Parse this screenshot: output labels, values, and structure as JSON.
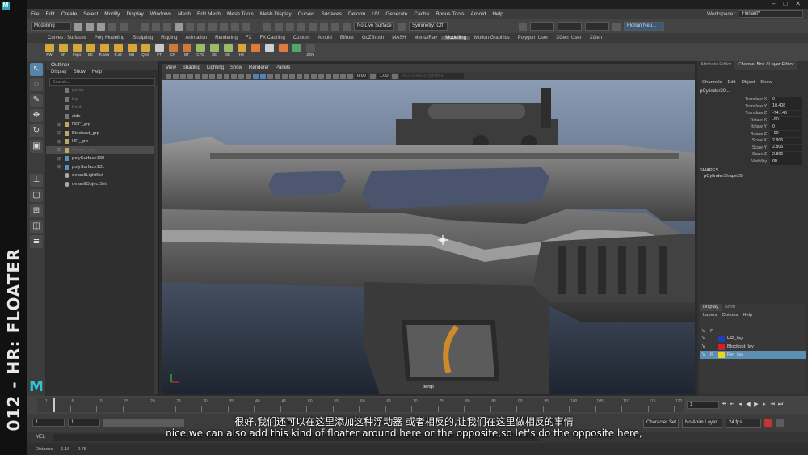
{
  "banner": {
    "text": "012 - HR: FLOATER",
    "logo": "M"
  },
  "menubar": {
    "items": [
      "File",
      "Edit",
      "Create",
      "Select",
      "Modify",
      "Display",
      "Windows",
      "Mesh",
      "Edit Mesh",
      "Mesh Tools",
      "Mesh Display",
      "Curves",
      "Surfaces",
      "Deform",
      "UV",
      "Generate",
      "Cache",
      "Bonus Tools",
      "Arnold",
      "Help"
    ],
    "workspace_label": "Workspace :",
    "workspace_value": "Floriant*"
  },
  "statusline": {
    "mode": "Modelling",
    "no_live_surface": "No Live Surface",
    "symmetry": "Symmetry: Off",
    "user": "Florian Neu..."
  },
  "shelf": {
    "tabs": [
      "Curves / Surfaces",
      "Poly Modeling",
      "Sculpting",
      "Rigging",
      "Animation",
      "Rendering",
      "FX",
      "FX Caching",
      "Custom",
      "Arnold",
      "Bifrost",
      "GoZBrush",
      "MASH",
      "MentalRay",
      "Modelling",
      "Motion Graphics",
      "Polygon_User",
      "XGen_User",
      "XGen"
    ],
    "active_tab": "Modelling",
    "buttons": [
      {
        "label": "PW",
        "color": "#d8a73a"
      },
      {
        "label": "SP",
        "color": "#d8a73a"
      },
      {
        "label": "Impo",
        "color": "#d8a73a"
      },
      {
        "label": "EE",
        "color": "#d8a73a"
      },
      {
        "label": "R.sew",
        "color": "#d8a73a"
      },
      {
        "label": "R.all",
        "color": "#d8a73a"
      },
      {
        "label": "NH",
        "color": "#d8a73a"
      },
      {
        "label": "QSS",
        "color": "#d8a73a"
      },
      {
        "label": "FT",
        "color": "#c9c9c9"
      },
      {
        "label": "CP",
        "color": "#d07a3a"
      },
      {
        "label": "BT",
        "color": "#d07a3a"
      },
      {
        "label": "CFD",
        "color": "#9bbb6a"
      },
      {
        "label": "SE",
        "color": "#9bbb6a"
      },
      {
        "label": "SE",
        "color": "#9bbb6a"
      },
      {
        "label": "HE",
        "color": "#d8a73a"
      },
      {
        "label": "",
        "color": "#e07b39"
      },
      {
        "label": "",
        "color": "#cfcfcf"
      },
      {
        "label": "",
        "color": "#e07b39"
      },
      {
        "label": "",
        "color": "#58a36a"
      },
      {
        "label": "ZEN",
        "color": "#555555"
      }
    ]
  },
  "outliner": {
    "title": "Outliner",
    "menu": [
      "Display",
      "Show",
      "Help"
    ],
    "search_placeholder": "Search...",
    "items": [
      {
        "label": "persp",
        "type": "cam",
        "dim": true,
        "expand": false
      },
      {
        "label": "top",
        "type": "cam",
        "dim": true,
        "expand": false
      },
      {
        "label": "front",
        "type": "cam",
        "dim": true,
        "expand": false
      },
      {
        "label": "side",
        "type": "cam",
        "dim": false,
        "expand": false
      },
      {
        "label": "REF_grp",
        "type": "grp",
        "dim": false,
        "expand": true
      },
      {
        "label": "Blockout_grp",
        "type": "grp",
        "dim": false,
        "expand": true
      },
      {
        "label": "HR_grp",
        "type": "grp",
        "dim": false,
        "expand": true
      },
      {
        "label": "Floater_grp",
        "type": "grp",
        "dim": false,
        "expand": true,
        "selected": true
      },
      {
        "label": "polySurface130",
        "type": "mesh",
        "dim": false,
        "expand": true
      },
      {
        "label": "polySurface131",
        "type": "mesh",
        "dim": false,
        "expand": true
      },
      {
        "label": "defaultLightSet",
        "type": "set",
        "dim": false,
        "expand": false
      },
      {
        "label": "defaultObjectSet",
        "type": "set",
        "dim": false,
        "expand": false
      }
    ]
  },
  "viewport": {
    "menu": [
      "View",
      "Shading",
      "Lighting",
      "Show",
      "Renderer",
      "Panels"
    ],
    "near_value": "0.00",
    "far_value": "1.00",
    "colorspace": "ACES sRGB gamma",
    "camera_label": "persp"
  },
  "channelbox": {
    "tabs": [
      "Attribute Editor",
      "Channel Box / Layer Editor"
    ],
    "active_tab": "Channel Box / Layer Editor",
    "menu": [
      "Channels",
      "Edit",
      "Object",
      "Show"
    ],
    "object": "pCylinder30...",
    "channels": [
      {
        "name": "Translate X",
        "value": "0"
      },
      {
        "name": "Translate Y",
        "value": "10.408"
      },
      {
        "name": "Translate Z",
        "value": "-74.146"
      },
      {
        "name": "Rotate X",
        "value": "-90"
      },
      {
        "name": "Rotate Y",
        "value": "0"
      },
      {
        "name": "Rotate Z",
        "value": "-90"
      },
      {
        "name": "Scale X",
        "value": "2.806"
      },
      {
        "name": "Scale Y",
        "value": "2.806"
      },
      {
        "name": "Scale Z",
        "value": "2.806"
      },
      {
        "name": "Visibility",
        "value": "on"
      }
    ],
    "shapes_title": "SHAPES",
    "shape_name": "pCylinderShape30"
  },
  "layers": {
    "tabs": [
      "Display",
      "Anim"
    ],
    "menu": [
      "Layers",
      "Options",
      "Help"
    ],
    "header_v": "V",
    "header_p": "P",
    "rows": [
      {
        "name": "HR_lay",
        "color": "#1f3fb8",
        "v": "V",
        "p": "",
        "selected": false
      },
      {
        "name": "Blockout_lay",
        "color": "#d42020",
        "v": "V",
        "p": "",
        "selected": false
      },
      {
        "name": "Ref_lay",
        "color": "#e8d81a",
        "v": "V",
        "p": "R",
        "selected": true
      }
    ]
  },
  "timeslider": {
    "ticks": [
      "1",
      "5",
      "10",
      "15",
      "20",
      "25",
      "30",
      "35",
      "40",
      "45",
      "50",
      "55",
      "60",
      "65",
      "70",
      "75",
      "80",
      "85",
      "90",
      "95",
      "100",
      "105",
      "110",
      "115",
      "120"
    ],
    "current_frame": "1"
  },
  "rangeslider": {
    "start": "1",
    "start2": "1",
    "end": "120",
    "char_set": "Character Set",
    "anim_layer": "No Anim Layer",
    "fps": "24 fps"
  },
  "cmdline": {
    "label": "MEL"
  },
  "helpline": {
    "distance_label": "Distance",
    "distance_value": "1.16",
    "other_value": "0.78"
  },
  "subtitles": {
    "zh": "很好,我们还可以在这里添加这种浮动器 或者相反的,让我们在这里做相反的事情",
    "en": "nice,we can also add this kind of floater around here or the opposite,so let's do the opposite here,"
  }
}
